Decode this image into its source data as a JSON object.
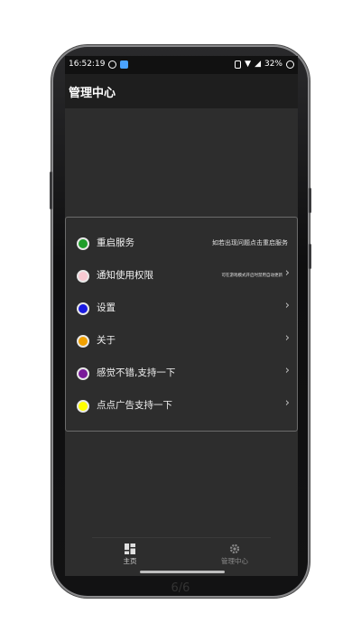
{
  "status_bar": {
    "time": "16:52:19",
    "battery": "32%"
  },
  "app_bar": {
    "title": "管理中心"
  },
  "menu": {
    "items": [
      {
        "label": "重启服务",
        "note": "如若出现问题点击重启服务",
        "dot_color": "#1f9e2a",
        "chevron": false
      },
      {
        "label": "通知使用权限",
        "note": "可在游戏模式开启时禁用自动更新",
        "dot_color": "#f7c9d2",
        "chevron": true
      },
      {
        "label": "设置",
        "note": "",
        "dot_color": "#1a1ae0",
        "chevron": true
      },
      {
        "label": "关于",
        "note": "",
        "dot_color": "#f0a000",
        "chevron": true
      },
      {
        "label": "感觉不错,支持一下",
        "note": "",
        "dot_color": "#7a1a9a",
        "chevron": true
      },
      {
        "label": "点点广告支持一下",
        "note": "",
        "dot_color": "#ffff00",
        "chevron": true
      }
    ]
  },
  "tabs": {
    "home": {
      "label": "主页",
      "icon": "grid-icon"
    },
    "admin": {
      "label": "管理中心",
      "icon": "gear-icon"
    }
  },
  "pager": "6/6"
}
